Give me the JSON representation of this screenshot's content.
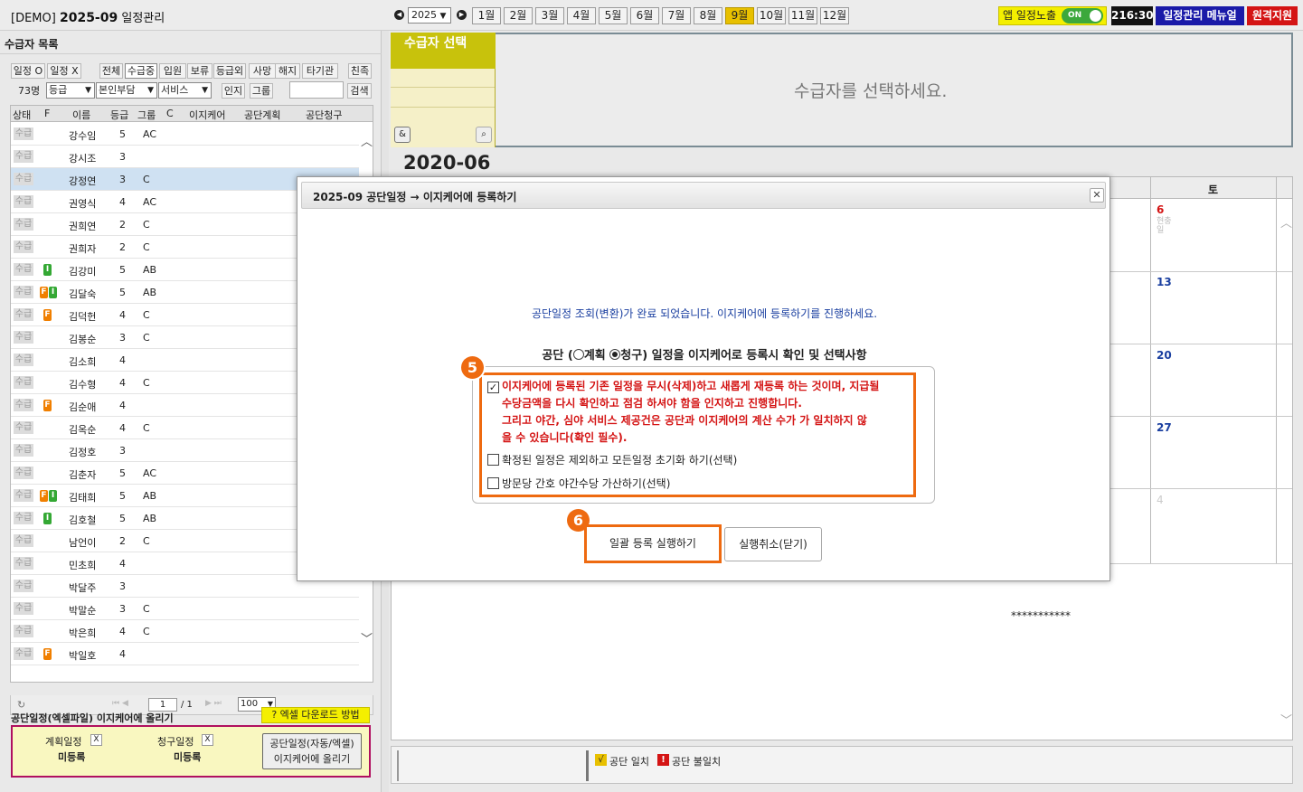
{
  "topbar": {
    "demo_tag": "[DEMO]",
    "app_title": "2025-09",
    "app_title_suffix": "일정관리",
    "year": "2025",
    "months": [
      "1월",
      "2월",
      "3월",
      "4월",
      "5월",
      "6월",
      "7월",
      "8월",
      "9월",
      "10월",
      "11월",
      "12월"
    ],
    "active_month_index": 8,
    "app_show_label": "앱 일정노출",
    "toggle_label": "ON",
    "clock": "216:30",
    "manual_label": "일정관리 메뉴얼",
    "remote_label": "원격지원"
  },
  "left": {
    "title": "수급자 목록",
    "schedule_o": "일정 O",
    "schedule_x": "일정 X",
    "status_filters": [
      "전체",
      "수급중",
      "입원",
      "보류",
      "등급외",
      "사망",
      "해지",
      "타기관"
    ],
    "relatives": "친족",
    "count": "73명",
    "grade_select": "등급",
    "copay_select": "본인부담",
    "service_select": "서비스",
    "auth_btn": "인지",
    "group_btn": "그룹",
    "search_btn": "검색",
    "columns": [
      "상태",
      "F",
      "이름",
      "등급",
      "그룹",
      "C",
      "이지케어",
      "공단계획",
      "공단청구"
    ],
    "rows": [
      {
        "status": "수급",
        "f": "",
        "name": "강수임",
        "grade": "5",
        "group": "AC"
      },
      {
        "status": "수급",
        "f": "",
        "name": "강시조",
        "grade": "3",
        "group": ""
      },
      {
        "status": "수급",
        "f": "",
        "name": "강정연",
        "grade": "3",
        "group": "C"
      },
      {
        "status": "수급",
        "f": "",
        "name": "권영식",
        "grade": "4",
        "group": "AC"
      },
      {
        "status": "수급",
        "f": "",
        "name": "권희연",
        "grade": "2",
        "group": "C"
      },
      {
        "status": "수급",
        "f": "",
        "name": "권희자",
        "grade": "2",
        "group": "C"
      },
      {
        "status": "수급",
        "f": "I",
        "name": "김강미",
        "grade": "5",
        "group": "AB"
      },
      {
        "status": "수급",
        "f": "FI",
        "name": "김달숙",
        "grade": "5",
        "group": "AB"
      },
      {
        "status": "수급",
        "f": "F",
        "name": "김덕헌",
        "grade": "4",
        "group": "C"
      },
      {
        "status": "수급",
        "f": "",
        "name": "김봉순",
        "grade": "3",
        "group": "C"
      },
      {
        "status": "수급",
        "f": "",
        "name": "김소희",
        "grade": "4",
        "group": ""
      },
      {
        "status": "수급",
        "f": "",
        "name": "김수형",
        "grade": "4",
        "group": "C"
      },
      {
        "status": "수급",
        "f": "F",
        "name": "김순애",
        "grade": "4",
        "group": ""
      },
      {
        "status": "수급",
        "f": "",
        "name": "김옥순",
        "grade": "4",
        "group": "C"
      },
      {
        "status": "수급",
        "f": "",
        "name": "김정호",
        "grade": "3",
        "group": ""
      },
      {
        "status": "수급",
        "f": "",
        "name": "김춘자",
        "grade": "5",
        "group": "AC"
      },
      {
        "status": "수급",
        "f": "FI",
        "name": "김태희",
        "grade": "5",
        "group": "AB"
      },
      {
        "status": "수급",
        "f": "I",
        "name": "김호철",
        "grade": "5",
        "group": "AB"
      },
      {
        "status": "수급",
        "f": "",
        "name": "남언이",
        "grade": "2",
        "group": "C"
      },
      {
        "status": "수급",
        "f": "",
        "name": "민초희",
        "grade": "4",
        "group": ""
      },
      {
        "status": "수급",
        "f": "",
        "name": "박달주",
        "grade": "3",
        "group": ""
      },
      {
        "status": "수급",
        "f": "",
        "name": "박말순",
        "grade": "3",
        "group": "C"
      },
      {
        "status": "수급",
        "f": "",
        "name": "박은희",
        "grade": "4",
        "group": "C"
      },
      {
        "status": "수급",
        "f": "F",
        "name": "박일호",
        "grade": "4",
        "group": ""
      }
    ],
    "selected_row_index": 2,
    "pager_page": "1",
    "pager_total": "/ 1",
    "page_size": "100",
    "excel_title": "공단일정(엑셀파일) 이지케어에 올리기",
    "excel_help": "? 엑셀 다운로드 방법",
    "plan_label": "계획일정",
    "plan_state": "미등록",
    "claim_label": "청구일정",
    "claim_state": "미등록",
    "x_mark": "X",
    "upload_line1": "공단일정(자동/엑셀)",
    "upload_line2": "이지케어에 올리기"
  },
  "right": {
    "select_title": "수급자 선택",
    "select_hint": "수급자를 선택하세요.",
    "amp_btn": "&",
    "month_label": "2020-06",
    "sat_header": "토",
    "sat_days": [
      "6",
      "13",
      "20",
      "27"
    ],
    "faded_day": "4",
    "stars": "***********",
    "legend_match": "공단 일치",
    "legend_mismatch": "공단 불일치",
    "legend_match_icon": "√",
    "legend_mismatch_icon": "!"
  },
  "modal": {
    "title": "2025-09 공단일정 → 이지케어에 등록하기",
    "close": "✕",
    "message": "공단일정 조회(변환)가 완료 되었습니다. 이지케어에 등록하기를 진행하세요.",
    "confirm_prefix": "공단 (",
    "radio_plan": "계획",
    "radio_claim": "청구",
    "confirm_suffix": ") 일정을 이지케어로 등록시 확인 및 선택사항",
    "opt1_line1": "이지케어에 등록된 기존 일정을 무시(삭제)하고 새롭게 재등록 하는 것이며, 지급될",
    "opt1_line2": "수당금액을 다시 확인하고 점검 하셔야 함을 인지하고 진행합니다.",
    "opt1_line3": "그리고 야간, 심야 서비스 제공건은 공단과 이지케어의 계산 수가 가 일치하지 않",
    "opt1_line4": "을 수 있습니다(확인 필수).",
    "opt1_checked": true,
    "opt2": "확정된 일정은 제외하고 모든일정 초기화 하기(선택)",
    "opt3": "방문당 간호 야간수당 가산하기(선택)",
    "callout5": "5",
    "callout6": "6",
    "run_btn": "일괄 등록 실행하기",
    "cancel_btn": "실행취소(닫기)"
  }
}
